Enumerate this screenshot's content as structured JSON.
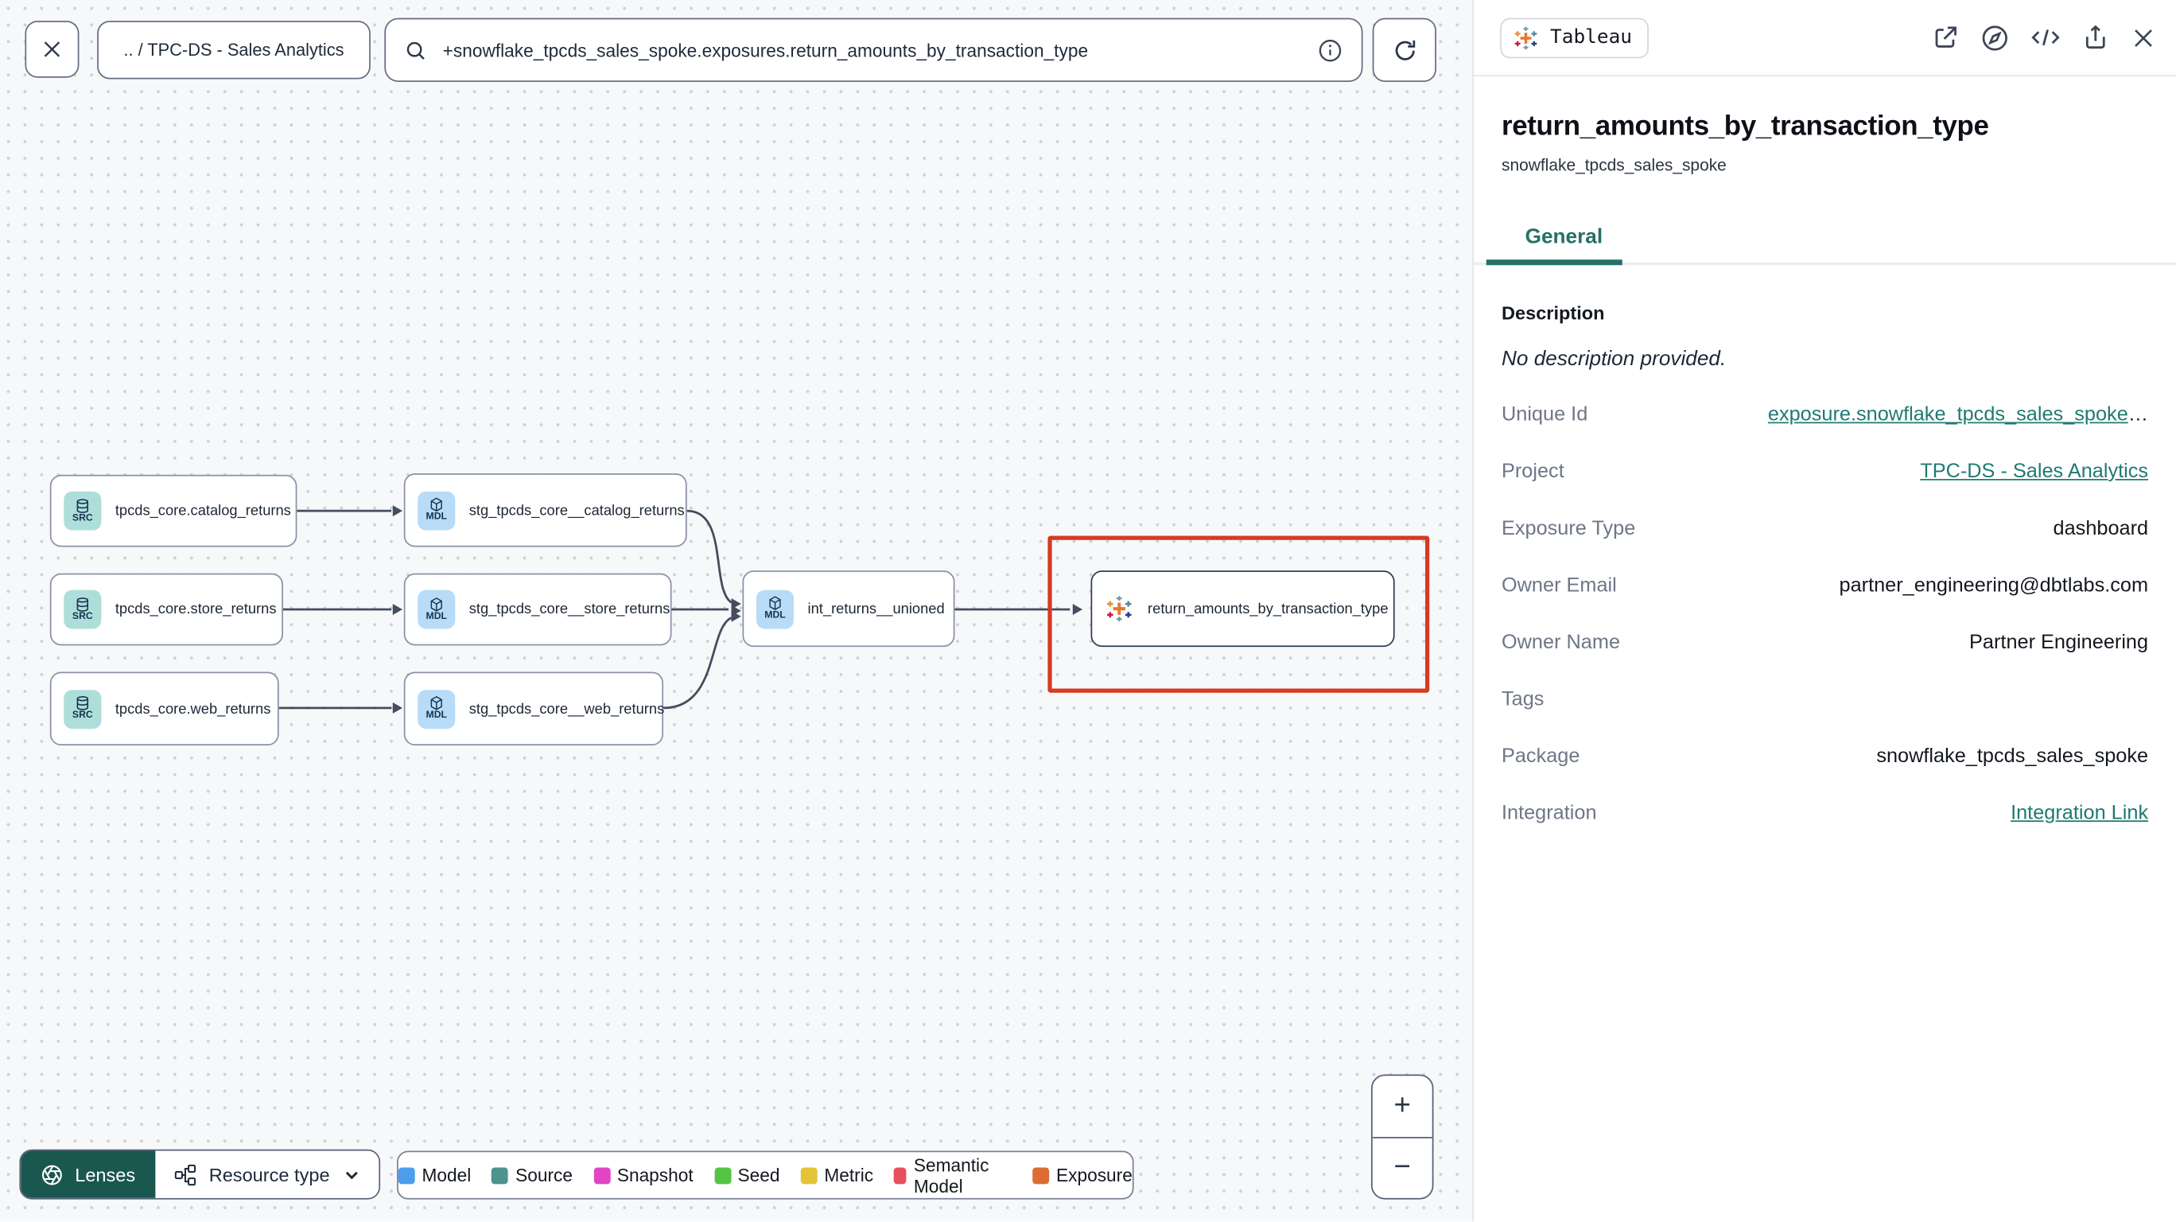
{
  "toolbar": {
    "breadcrumb": ".. / TPC-DS - Sales Analytics",
    "search_value": "+snowflake_tpcds_sales_spoke.exposures.return_amounts_by_transaction_type"
  },
  "graph": {
    "nodes": [
      {
        "label": "tpcds_core.catalog_returns",
        "badge": "SRC",
        "type": "source"
      },
      {
        "label": "tpcds_core.store_returns",
        "badge": "SRC",
        "type": "source"
      },
      {
        "label": "tpcds_core.web_returns",
        "badge": "SRC",
        "type": "source"
      },
      {
        "label": "stg_tpcds_core__catalog_returns",
        "badge": "MDL",
        "type": "model"
      },
      {
        "label": "stg_tpcds_core__store_returns",
        "badge": "MDL",
        "type": "model"
      },
      {
        "label": "stg_tpcds_core__web_returns",
        "badge": "MDL",
        "type": "model"
      },
      {
        "label": "int_returns__unioned",
        "badge": "MDL",
        "type": "model"
      },
      {
        "label": "return_amounts_by_transaction_type",
        "badge": "tableau-logo",
        "type": "exposure",
        "selected": true
      }
    ]
  },
  "controls": {
    "lenses_label": "Lenses",
    "resource_type_label": "Resource type",
    "zoom_in": "+",
    "zoom_out": "−"
  },
  "legend": {
    "items": [
      {
        "label": "Model",
        "color": "#4d9eea"
      },
      {
        "label": "Source",
        "color": "#4d938e"
      },
      {
        "label": "Snapshot",
        "color": "#e244c5"
      },
      {
        "label": "Seed",
        "color": "#54c442"
      },
      {
        "label": "Metric",
        "color": "#e4c339"
      },
      {
        "label": "Semantic Model",
        "color": "#e94f5d"
      },
      {
        "label": "Exposure",
        "color": "#dd6b33"
      }
    ]
  },
  "panel": {
    "integration_badge": "Tableau",
    "title": "return_amounts_by_transaction_type",
    "subtitle": "snowflake_tpcds_sales_spoke",
    "tab_general": "General",
    "description_heading": "Description",
    "description_empty": "No description provided.",
    "accent_color": "#257069",
    "fields": [
      {
        "label": "Unique Id",
        "value": "exposure.snowflake_tpcds_sales_spoke",
        "suffix": "…",
        "link": true
      },
      {
        "label": "Project",
        "value": "TPC-DS - Sales Analytics",
        "link": true
      },
      {
        "label": "Exposure Type",
        "value": "dashboard"
      },
      {
        "label": "Owner Email",
        "value": "partner_engineering@dbtlabs.com"
      },
      {
        "label": "Owner Name",
        "value": "Partner Engineering"
      },
      {
        "label": "Tags",
        "value": ""
      },
      {
        "label": "Package",
        "value": "snowflake_tpcds_sales_spoke"
      },
      {
        "label": "Integration",
        "value": "Integration Link",
        "link": true
      }
    ]
  },
  "icons": {
    "close": "✕",
    "search": "magnifier",
    "info": "ⓘ",
    "refresh": "circular-arrow",
    "external_link": "arrow-out-of-box",
    "explore": "compass",
    "code": "</>",
    "share": "arrow-up-from-box",
    "source": "database",
    "model": "cube",
    "lenses": "aperture",
    "resource_type": "node-tree",
    "chevron_down": "∨"
  }
}
